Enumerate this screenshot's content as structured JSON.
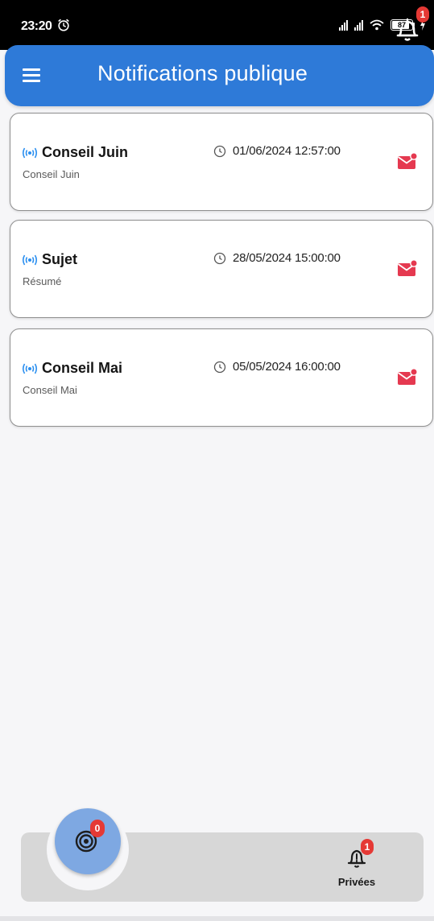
{
  "status_bar": {
    "time": "23:20",
    "battery": "87"
  },
  "header": {
    "title": "Notifications publique",
    "notification_count": "1"
  },
  "notifications": [
    {
      "title": "Conseil Juin",
      "summary": "Conseil Juin",
      "date": "01/06/2024 12:57:00"
    },
    {
      "title": "Sujet",
      "summary": "Résumé",
      "date": "28/05/2024 15:00:00"
    },
    {
      "title": "Conseil Mai",
      "summary": "Conseil Mai",
      "date": "05/05/2024 16:00:00"
    }
  ],
  "bottom_nav": {
    "fab_count": "0",
    "private_count": "1",
    "private_label": "Privées"
  },
  "colors": {
    "header": "#2e7ad8",
    "broadcast_icon": "#2a8ff0",
    "mail_icon": "#e53950",
    "badge": "#e53935",
    "fab": "#7ea8e2"
  },
  "icons": [
    "alarm-icon",
    "menu-icon",
    "bell-icon",
    "broadcast-icon",
    "clock-icon",
    "mail-icon",
    "target-icon"
  ]
}
